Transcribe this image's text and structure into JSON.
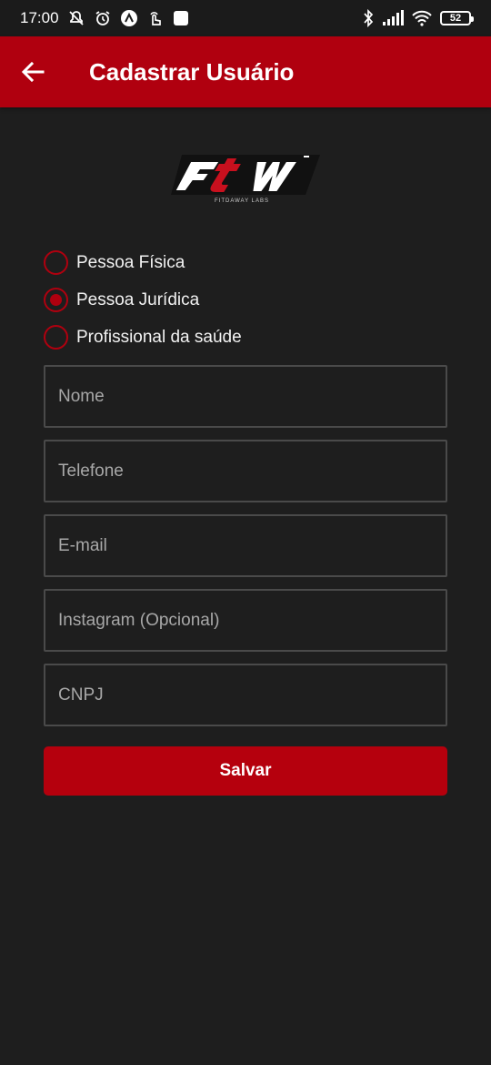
{
  "status_bar": {
    "time": "17:00",
    "battery": "52",
    "icons": [
      "mute-icon",
      "alarm-icon",
      "app-icon",
      "gesture-icon",
      "square-icon",
      "bluetooth-icon",
      "signal-icon",
      "wifi-icon",
      "battery-icon"
    ]
  },
  "app_bar": {
    "title": "Cadastrar Usuário",
    "back_icon": "arrow-left-icon"
  },
  "logo": {
    "text": "FTW",
    "subtext": "FITDAWAY LABS"
  },
  "account_type": {
    "options": [
      {
        "label": "Pessoa Física",
        "selected": false
      },
      {
        "label": "Pessoa Jurídica",
        "selected": true
      },
      {
        "label": "Profissional da saúde",
        "selected": false
      }
    ]
  },
  "form": {
    "fields": [
      {
        "placeholder": "Nome",
        "value": ""
      },
      {
        "placeholder": "Telefone",
        "value": ""
      },
      {
        "placeholder": "E-mail",
        "value": ""
      },
      {
        "placeholder": "Instagram (Opcional)",
        "value": ""
      },
      {
        "placeholder": "CNPJ",
        "value": ""
      }
    ],
    "save_label": "Salvar"
  },
  "colors": {
    "accent": "#b0000f",
    "background": "#1e1e1e",
    "field_border": "#4a4a4a"
  }
}
